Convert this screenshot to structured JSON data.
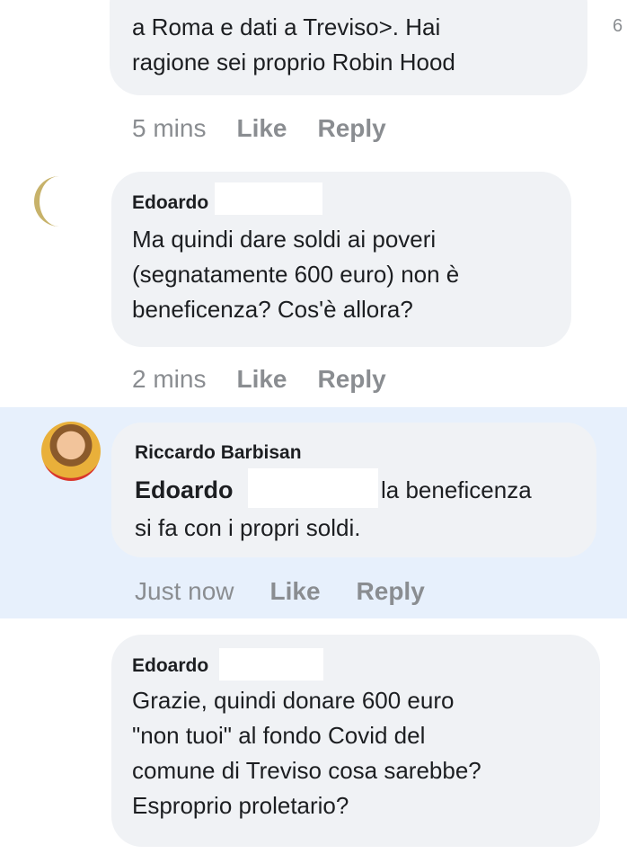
{
  "edge_text": "6",
  "comments": [
    {
      "text": "a Roma e dati a Treviso>. Hai\nragione sei proprio Robin Hood",
      "time": "5 mins",
      "like": "Like",
      "reply": "Reply"
    },
    {
      "author": "Edoardo",
      "text": "Ma quindi dare soldi ai poveri\n(segnatamente 600 euro) non è\nbeneficenza? Cos'è allora?",
      "time": "2 mins",
      "like": "Like",
      "reply": "Reply"
    },
    {
      "author": "Riccardo Barbisan",
      "mention": "Edoardo",
      "text": "la beneficenza",
      "text2": "si fa con i propri soldi.",
      "time": "Just now",
      "like": "Like",
      "reply": "Reply",
      "highlighted": true
    },
    {
      "author": "Edoardo",
      "text": "Grazie, quindi donare 600 euro\n\"non tuoi\" al fondo Covid del\ncomune di Treviso cosa sarebbe?\nEsproprio proletario?"
    }
  ]
}
